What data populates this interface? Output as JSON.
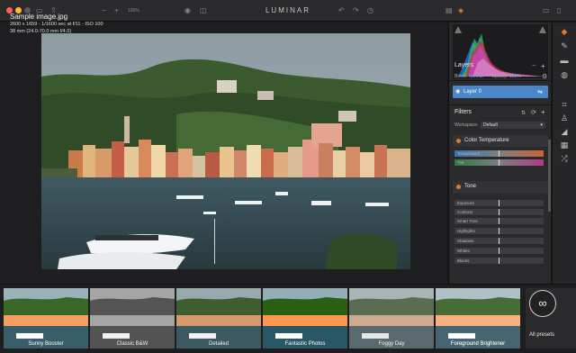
{
  "app": {
    "title": "LUMINAR",
    "zoom": "100%"
  },
  "image_info": {
    "filename": "Sample image.jpg",
    "dimensions_line": "2600 x 1659 · 1/1600 sec at f/11 · ISO 100",
    "lens_line": "38 mm (24.0-70.0 mm f/4.0)"
  },
  "layers": {
    "title": "Layers",
    "blend_label": "Blend:",
    "blend_value": "Normal",
    "opacity_label": "Opacity:",
    "opacity_value": "100%",
    "layer_name": "Layer 0"
  },
  "filters": {
    "title": "Filters",
    "workspace_label": "Workspace:",
    "workspace_value": "Default",
    "items": [
      {
        "name": "Color Temperature",
        "sliders": [
          {
            "label": "Temperature",
            "value": 0.5
          },
          {
            "label": "Tint",
            "value": 0.5
          }
        ]
      },
      {
        "name": "Tone",
        "sliders": [
          {
            "label": "Exposure",
            "value": 0.5
          },
          {
            "label": "Contrast",
            "value": 0.5
          },
          {
            "label": "Smart Tone",
            "value": 0.5
          },
          {
            "label": "Highlights",
            "value": 0.5
          },
          {
            "label": "Shadows",
            "value": 0.5
          },
          {
            "label": "Whites",
            "value": 0.5
          },
          {
            "label": "Blacks",
            "value": 0.5
          }
        ]
      }
    ]
  },
  "presets": [
    {
      "label": "Sunny Booster",
      "tone": "warm"
    },
    {
      "label": "Classic B&W",
      "tone": "bw"
    },
    {
      "label": "Detailed",
      "tone": "normal"
    },
    {
      "label": "Fantastic Photos",
      "tone": "vivid"
    },
    {
      "label": "Foggy Day",
      "tone": "faded"
    },
    {
      "label": "Foreground Brightener",
      "tone": "bright"
    }
  ],
  "all_presets": {
    "label": "All presets",
    "icon": "infinity-icon"
  },
  "colors": {
    "accent": "#4b86c8",
    "orange": "#e07a2a",
    "panel": "#2a2a2c"
  }
}
